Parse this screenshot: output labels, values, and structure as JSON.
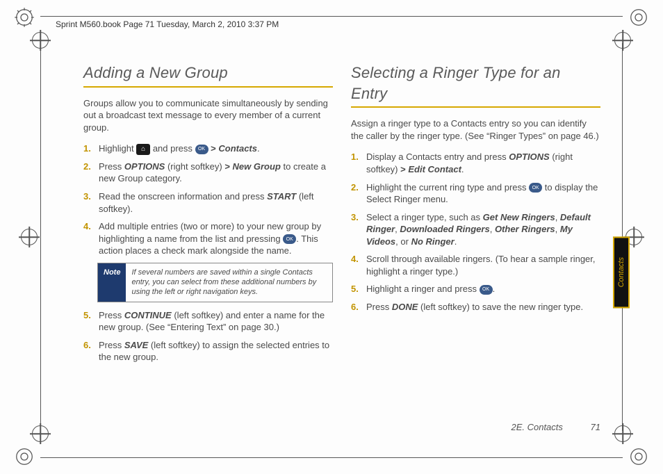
{
  "header": "Sprint M560.book  Page 71  Tuesday, March 2, 2010  3:37 PM",
  "left": {
    "title": "Adding a New Group",
    "intro": "Groups allow you to communicate simultaneously by sending out a broadcast text message to every member of a current group.",
    "s1_a": "Highlight ",
    "s1_b": " and press ",
    "s1_c": "Contacts",
    "s1_d": ".",
    "s2_a": "Press ",
    "s2_b": "OPTIONS",
    "s2_c": " (right softkey) ",
    "s2_d": "New Group",
    "s2_e": " to create a new Group category.",
    "s3_a": "Read the onscreen information and press ",
    "s3_b": "START",
    "s3_c": " (left softkey).",
    "s4_a": "Add multiple entries (two or more) to your new group by highlighting a name from the list and pressing ",
    "s4_b": ". This action places a check mark alongside the name.",
    "note_label": "Note",
    "note_text": "If several numbers are saved within a single Contacts entry, you can select from these additional numbers by using the left or right navigation keys.",
    "s5_a": "Press ",
    "s5_b": "CONTINUE",
    "s5_c": " (left softkey) and enter a name for the new group. (See “Entering Text” on page 30.)",
    "s6_a": "Press ",
    "s6_b": "SAVE",
    "s6_c": " (left softkey) to assign the selected entries to the new group."
  },
  "right": {
    "title": "Selecting a Ringer Type for an Entry",
    "intro": "Assign a ringer type to a Contacts entry so you can identify the caller by the ringer type. (See “Ringer Types” on page 46.)",
    "s1_a": "Display a Contacts entry and press ",
    "s1_b": "OPTIONS",
    "s1_c": " (right softkey) ",
    "s1_d": "Edit Contact",
    "s1_e": ".",
    "s2_a": "Highlight the current ring type and press ",
    "s2_b": " to display the Select Ringer menu.",
    "s3_a": "Select a ringer type, such as ",
    "s3_b": "Get New Ringers",
    "s3_c": ", ",
    "s3_d": "Default Ringer",
    "s3_e": ", ",
    "s3_f": "Downloaded Ringers",
    "s3_g": ", ",
    "s3_h": "Other Ringers",
    "s3_i": ", ",
    "s3_j": "My Videos",
    "s3_k": ", or ",
    "s3_l": "No Ringer",
    "s3_m": ".",
    "s4": "Scroll through available ringers. (To hear a sample ringer, highlight a ringer type.)",
    "s5_a": "Highlight a ringer and press ",
    "s5_b": ".",
    "s6_a": "Press ",
    "s6_b": "DONE",
    "s6_c": " (left softkey) to save the new ringer type."
  },
  "sideTab": "Contacts",
  "footer_section": "2E. Contacts",
  "footer_page": "71",
  "ok_label": "OK",
  "gt": ">"
}
